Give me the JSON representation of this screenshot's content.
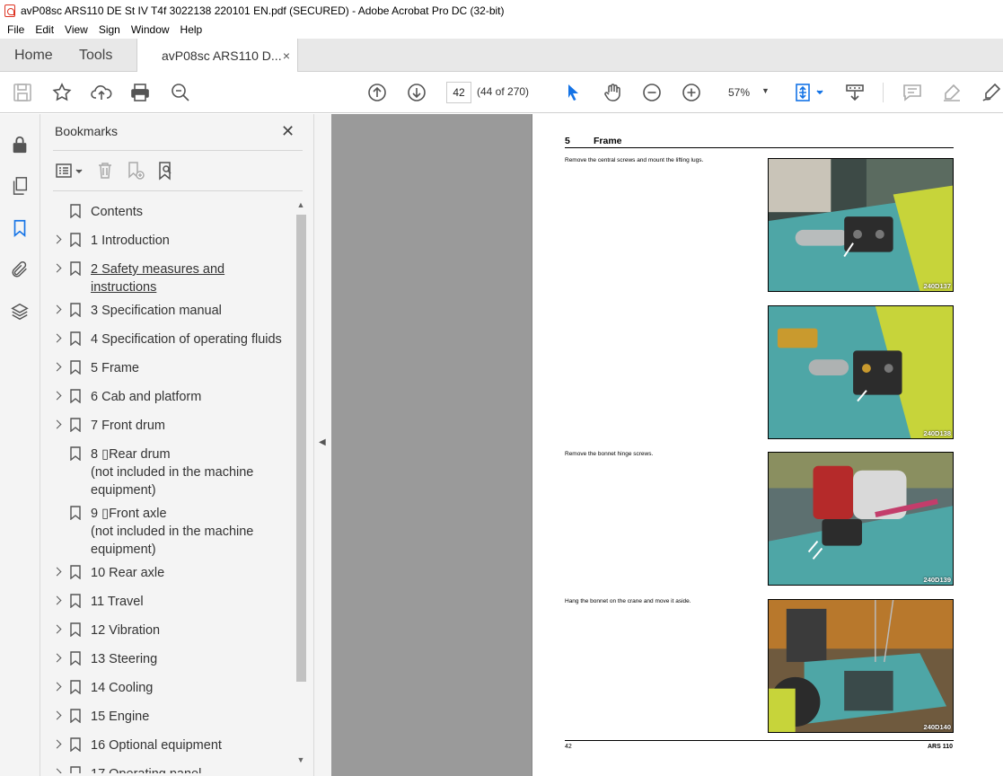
{
  "window": {
    "title": "avP08sc ARS110 DE St IV T4f 3022138 220101 EN.pdf (SECURED) - Adobe Acrobat Pro DC (32-bit)"
  },
  "menu": [
    "File",
    "Edit",
    "View",
    "Sign",
    "Window",
    "Help"
  ],
  "tabs": {
    "home": "Home",
    "tools": "Tools",
    "document": "avP08sc ARS110 D...",
    "close": "×"
  },
  "toolbar": {
    "page_number": "42",
    "page_count": "(44 of 270)",
    "zoom": "57%",
    "zoom_caret": "▼",
    "icons": [
      "save-icon",
      "star-icon",
      "upload-icon",
      "print-icon",
      "search-zoom-icon",
      "arrow-up-icon",
      "arrow-down-icon",
      "select-pointer-icon",
      "hand-icon",
      "zoom-out-icon",
      "zoom-in-icon",
      "fit-page-icon",
      "scroll-mode-icon",
      "comment-icon",
      "highlight-icon",
      "sign-icon"
    ]
  },
  "rail": {
    "icons": [
      "lock-icon",
      "pages-icon",
      "bookmark-icon",
      "attachment-icon",
      "layers-icon"
    ]
  },
  "bookmarks": {
    "header": "Bookmarks",
    "close": "✕",
    "items": [
      {
        "label": "Contents",
        "expandable": false
      },
      {
        "label": "1 Introduction",
        "expandable": true
      },
      {
        "label": "2 Safety measures and \ninstructions",
        "expandable": true,
        "underline": true
      },
      {
        "label": "3 Specification manual",
        "expandable": true
      },
      {
        "label": "4 Specification of operating fluids",
        "expandable": true
      },
      {
        "label": "5 Frame",
        "expandable": true
      },
      {
        "label": "6 Cab and platform",
        "expandable": true
      },
      {
        "label": "7 Front drum",
        "expandable": true
      },
      {
        "label": "8 ▯Rear drum\n(not included in the machine\nequipment)",
        "expandable": false
      },
      {
        "label": "9 ▯Front axle\n(not included in the machine\nequipment)",
        "expandable": false
      },
      {
        "label": "10 Rear axle",
        "expandable": true
      },
      {
        "label": "11 Travel",
        "expandable": true
      },
      {
        "label": "12 Vibration",
        "expandable": true
      },
      {
        "label": "13 Steering",
        "expandable": true
      },
      {
        "label": "14 Cooling",
        "expandable": true
      },
      {
        "label": "15 Engine",
        "expandable": true
      },
      {
        "label": "16 Optional equipment",
        "expandable": true
      },
      {
        "label": "17 Operating panel",
        "expandable": true
      }
    ]
  },
  "document_page": {
    "section_number": "5",
    "section_title": "Frame",
    "steps": [
      "Remove the central screws and mount the lifting lugs.",
      "Remove the bonnet hinge screws.",
      "Hang the bonnet on the crane and move it aside."
    ],
    "photos": [
      "240D137",
      "240D138",
      "240D139",
      "240D140"
    ],
    "footer_page": "42",
    "footer_model": "ARS 110"
  },
  "colors": {
    "accent": "#1473e6",
    "panel_bg": "#f4f4f4",
    "canvas_bg": "#9a9a9a",
    "machine_teal": "#4ea6a6",
    "machine_yellow": "#c7d43a"
  }
}
